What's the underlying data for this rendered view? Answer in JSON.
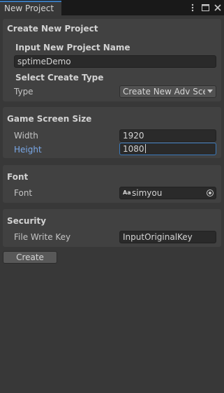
{
  "window": {
    "tab_title": "New Project",
    "icons": [
      "kebab-menu-icon",
      "maximize-icon",
      "close-icon"
    ]
  },
  "create_new_project": {
    "title": "Create New Project",
    "project_name": {
      "heading": "Input New Project Name",
      "value": "sptimeDemo"
    },
    "create_type": {
      "heading": "Select Create Type",
      "label": "Type",
      "selected": "Create New Adv Scene"
    }
  },
  "game_screen_size": {
    "title": "Game Screen Size",
    "width_label": "Width",
    "width_value": "1920",
    "height_label": "Height",
    "height_value": "1080"
  },
  "font": {
    "title": "Font",
    "label": "Font",
    "icon_text": "Aa",
    "value": "simyou"
  },
  "security": {
    "title": "Security",
    "label": "File Write Key",
    "value": "InputOriginalKey"
  },
  "actions": {
    "create_label": "Create"
  },
  "colors": {
    "background": "#383838",
    "panel": "#414141",
    "accent": "#3a79bb",
    "active_label": "#7aa8e8"
  }
}
